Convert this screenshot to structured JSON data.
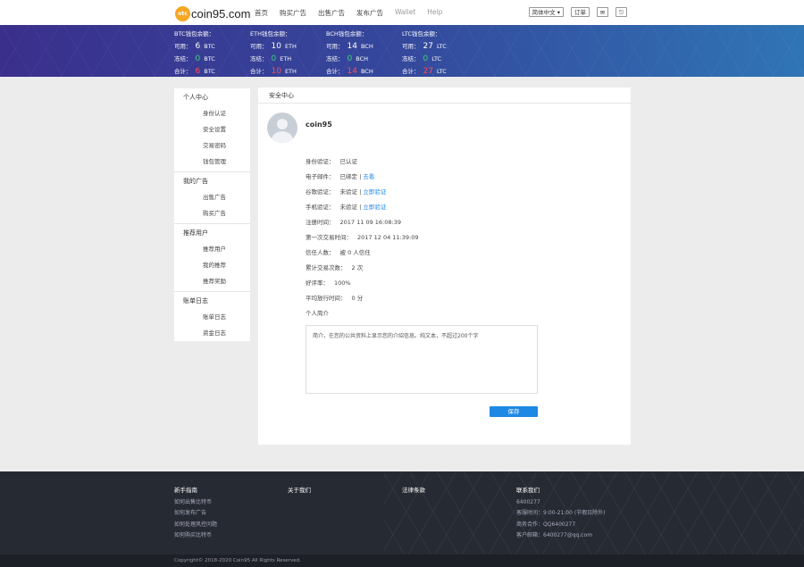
{
  "header": {
    "logo_badge": "otc",
    "logo_text": "coin95.com",
    "nav": [
      "首页",
      "购买广告",
      "出售广告",
      "发布广告",
      "Wallet",
      "Help"
    ],
    "lang_button": "简体中文 ▾",
    "user_button": "订单",
    "msg_icon_label": "✉",
    "logout_icon_label": "⎋"
  },
  "balances": [
    {
      "title": "BTC钱包余额：",
      "available_label": "可用：",
      "available": "6",
      "frozen_label": "冻结：",
      "frozen": "0",
      "total_label": "合计：",
      "total": "6",
      "unit": "BTC"
    },
    {
      "title": "ETH钱包余额：",
      "available_label": "可用：",
      "available": "10",
      "frozen_label": "冻结：",
      "frozen": "0",
      "total_label": "合计：",
      "total": "10",
      "unit": "ETH"
    },
    {
      "title": "BCH钱包余额：",
      "available_label": "可用：",
      "available": "14",
      "frozen_label": "冻结：",
      "frozen": "0",
      "total_label": "合计：",
      "total": "14",
      "unit": "BCH"
    },
    {
      "title": "LTC钱包余额：",
      "available_label": "可用：",
      "available": "27",
      "frozen_label": "冻结：",
      "frozen": "0",
      "total_label": "合计：",
      "total": "27",
      "unit": "LTC"
    }
  ],
  "sidebar": {
    "groups": [
      {
        "title": "个人中心",
        "items": [
          "身份认证",
          "安全设置",
          "交易密码",
          "钱包管理"
        ]
      },
      {
        "title": "我的广告",
        "items": [
          "出售广告",
          "购买广告"
        ]
      },
      {
        "title": "推荐用户",
        "items": [
          "推荐用户",
          "我的推荐",
          "推荐奖励"
        ]
      },
      {
        "title": "账单日志",
        "items": [
          "账单日志",
          "资金日志"
        ]
      }
    ]
  },
  "main": {
    "section_title": "安全中心",
    "username": "coin95",
    "rows": [
      {
        "label": "身份验证：",
        "value": "已认证",
        "link": ""
      },
      {
        "label": "电子邮件：",
        "value": "已绑定 |",
        "link": "去看"
      },
      {
        "label": "谷歌验证：",
        "value": "未验证 |",
        "link": "立即验证"
      },
      {
        "label": "手机验证：",
        "value": "未验证 |",
        "link": "立即验证"
      },
      {
        "label": "注册时间：",
        "value": "2017 11 09 16:08:39",
        "link": ""
      },
      {
        "label": "第一次交易时间：",
        "value": "2017 12 04 11:39:09",
        "link": ""
      },
      {
        "label": "信任人数：",
        "value": "被 0 人信任",
        "link": ""
      },
      {
        "label": "累计交易次数：",
        "value": "2 次",
        "link": ""
      },
      {
        "label": "好评率：",
        "value": "100%",
        "link": ""
      },
      {
        "label": "平均放行时间：",
        "value": "0 分",
        "link": ""
      },
      {
        "label": "个人简介",
        "value": "",
        "link": ""
      }
    ],
    "intro_placeholder": "简介，在您的公共资料上显示您的介绍信息。纯文本，不超过200个字",
    "save_label": "保存"
  },
  "footer": {
    "columns": [
      {
        "title": "新手指南",
        "items": [
          "如何出售比特币",
          "如何发布广告",
          "如何处理风控问题",
          "如何购买比特币"
        ]
      },
      {
        "title": "关于我们",
        "items": []
      },
      {
        "title": "法律条款",
        "items": []
      },
      {
        "title": "联系我们",
        "items": [
          "6400277",
          "客服时间：9:00-21:00 (节假日除外)",
          "商务合作：QQ6400277",
          "客户邮箱：6400277@qq.com"
        ]
      }
    ],
    "copyright": "Copyright© 2018-2020 Coin95 All Rights Reserved."
  }
}
